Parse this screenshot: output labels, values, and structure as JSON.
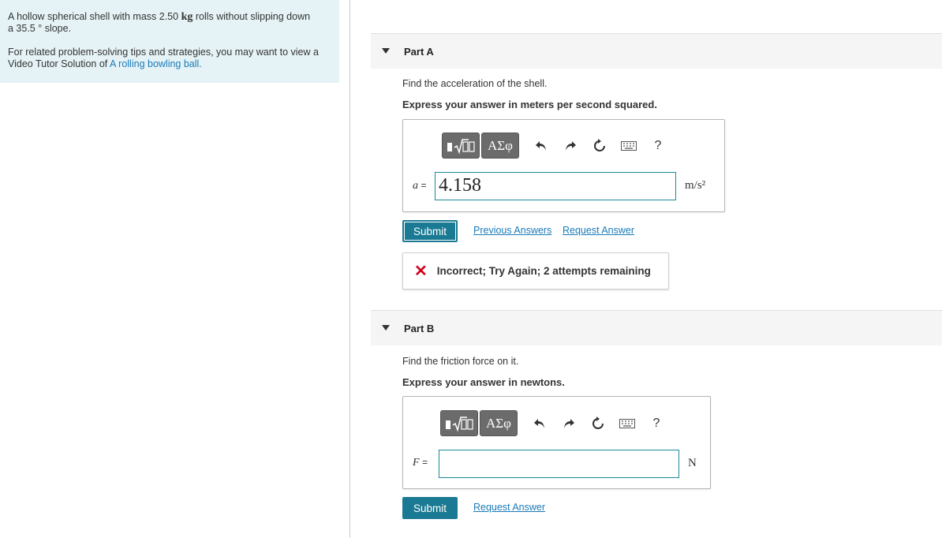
{
  "problem": {
    "statement_part1": "A hollow spherical shell with mass 2.50",
    "mass_unit": "kg",
    "statement_part2": "rolls without slipping down",
    "statement_line2": "a 35.5 ° slope.",
    "tips_text": "For related problem-solving tips and strategies, you may want to view a Video Tutor Solution of",
    "tips_link": "A rolling bowling ball."
  },
  "partA": {
    "title": "Part A",
    "question": "Find the acceleration of the shell.",
    "instruction": "Express your answer in meters per second squared.",
    "var_symbol": "a",
    "equals": "=",
    "value": "4.158",
    "unit": "m/s²",
    "toolbar": {
      "greek_label": "ΑΣφ",
      "help_label": "?"
    },
    "submit_label": "Submit",
    "previous_answers_label": "Previous Answers",
    "request_answer_label": "Request Answer",
    "feedback": "Incorrect; Try Again; 2 attempts remaining"
  },
  "partB": {
    "title": "Part B",
    "question": "Find the friction force on it.",
    "instruction": "Express your answer in newtons.",
    "var_symbol": "F",
    "equals": "=",
    "value": "",
    "unit": "N",
    "toolbar": {
      "greek_label": "ΑΣφ",
      "help_label": "?"
    },
    "submit_label": "Submit",
    "request_answer_label": "Request Answer"
  },
  "colors": {
    "accent": "#1b7a93",
    "link": "#1a7ab8",
    "error": "#d0021b",
    "panel": "#e6f3f6"
  }
}
